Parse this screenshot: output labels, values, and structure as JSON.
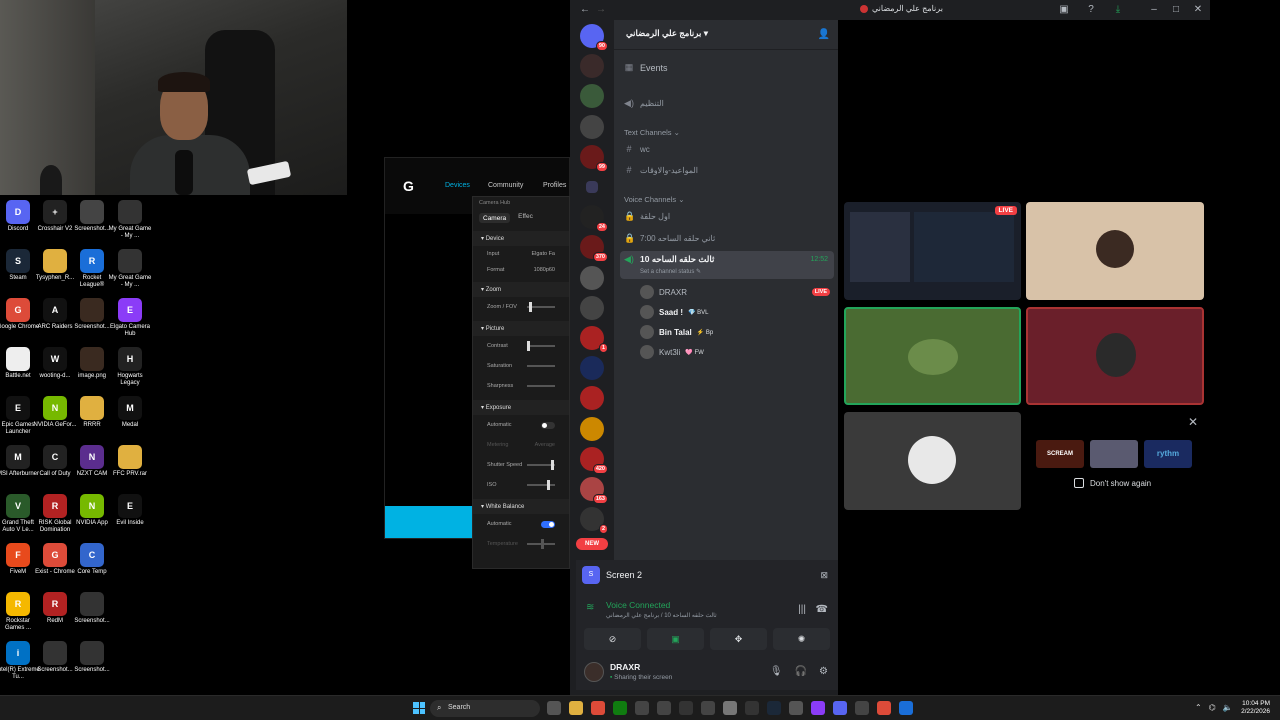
{
  "desktop": {
    "icons": [
      {
        "label": "Discord",
        "color": "#5865f2",
        "glyph": "D"
      },
      {
        "label": "Crosshair V2",
        "color": "#222222",
        "glyph": "+"
      },
      {
        "label": "Screenshot...",
        "color": "#444444",
        "glyph": ""
      },
      {
        "label": "My Great Game - My ...",
        "color": "#333333",
        "glyph": ""
      },
      {
        "label": "Steam",
        "color": "#1b2838",
        "glyph": "S"
      },
      {
        "label": "Tysyphen_R...",
        "color": "#e0b040",
        "glyph": ""
      },
      {
        "label": "Rocket League®",
        "color": "#1a6ed8",
        "glyph": "R"
      },
      {
        "label": "My Great Game - My ...",
        "color": "#333333",
        "glyph": ""
      },
      {
        "label": "Google Chrome",
        "color": "#dd4b39",
        "glyph": "G"
      },
      {
        "label": "ARC Raiders",
        "color": "#111111",
        "glyph": "A"
      },
      {
        "label": "Screenshot...",
        "color": "#3a2a20",
        "glyph": ""
      },
      {
        "label": "Elgato Camera Hub",
        "color": "#8b3cf7",
        "glyph": "E"
      },
      {
        "label": "Battle.net",
        "color": "#eeeeee",
        "glyph": ""
      },
      {
        "label": "wooting-d...",
        "color": "#111111",
        "glyph": "W"
      },
      {
        "label": "image.png",
        "color": "#3a2a20",
        "glyph": ""
      },
      {
        "label": "Hogwarts Legacy",
        "color": "#222222",
        "glyph": "H"
      },
      {
        "label": "Epic Games Launcher",
        "color": "#111111",
        "glyph": "E"
      },
      {
        "label": "NVIDIA GeFor...",
        "color": "#76b900",
        "glyph": "N"
      },
      {
        "label": "RRRR",
        "color": "#e0b040",
        "glyph": ""
      },
      {
        "label": "Medal",
        "color": "#111111",
        "glyph": "M"
      },
      {
        "label": "MSI Afterburner",
        "color": "#222222",
        "glyph": "M"
      },
      {
        "label": "Call of Duty",
        "color": "#222222",
        "glyph": "C"
      },
      {
        "label": "NZXT CAM",
        "color": "#5b2d8e",
        "glyph": "N"
      },
      {
        "label": "FFC PRV.rar",
        "color": "#e0b040",
        "glyph": ""
      },
      {
        "label": "Grand Theft Auto V Le...",
        "color": "#2a5a2a",
        "glyph": "V"
      },
      {
        "label": "RISK Global Domination",
        "color": "#b22222",
        "glyph": "R"
      },
      {
        "label": "NVIDIA App",
        "color": "#76b900",
        "glyph": "N"
      },
      {
        "label": "Evil Inside",
        "color": "#111111",
        "glyph": "E"
      },
      {
        "label": "FiveM",
        "color": "#e84a1c",
        "glyph": "F"
      },
      {
        "label": "Exist - Chrome",
        "color": "#dd4b39",
        "glyph": "G"
      },
      {
        "label": "Core Temp",
        "color": "#3366cc",
        "glyph": "C"
      },
      {
        "label": "",
        "color": "#000000",
        "glyph": ""
      },
      {
        "label": "Rockstar Games ...",
        "color": "#f5b800",
        "glyph": "R"
      },
      {
        "label": "RedM",
        "color": "#b22222",
        "glyph": "R"
      },
      {
        "label": "Screenshot...",
        "color": "#333333",
        "glyph": ""
      },
      {
        "label": "",
        "color": "#000000",
        "glyph": ""
      },
      {
        "label": "Intel(R) Extreme Tu...",
        "color": "#0071c5",
        "glyph": "i"
      },
      {
        "label": "Screenshot...",
        "color": "#333333",
        "glyph": ""
      },
      {
        "label": "Screenshot...",
        "color": "#333333",
        "glyph": ""
      }
    ]
  },
  "logitech": {
    "nav_devices": "Devices",
    "nav_community": "Community",
    "nav_profiles": "Profiles"
  },
  "camerahub": {
    "title": "Camera Hub",
    "tab_camera": "Camera",
    "tab_effects": "Effec",
    "sec_device": "Device",
    "input_label": "Input",
    "input_value": "Elgato Fa",
    "format_label": "Format",
    "format_value": "1080p60",
    "sec_zoom": "Zoom",
    "zoom_fov": "Zoom / FOV",
    "sec_picture": "Picture",
    "contrast": "Contrast",
    "saturation": "Saturation",
    "sharpness": "Sharpness",
    "sec_exposure": "Exposure",
    "automatic": "Automatic",
    "metering": "Metering",
    "metering_value": "Average",
    "shutter_speed": "Shutter Speed",
    "iso": "ISO",
    "sec_wb": "White Balance",
    "automatic2": "Automatic",
    "temperature": "Temperature"
  },
  "discord": {
    "window_title": "برنامج علي الرمضاني",
    "server_name": "برنامج علي الرمضاني",
    "events": "Events",
    "announce_channel": "التنظيم",
    "text_channels_label": "Text Channels",
    "text_channels": [
      "wc",
      "المواعيد-والاوقات"
    ],
    "voice_channels_label": "Voice Channels",
    "voice_channels": [
      "اول حلقة",
      "ثاني حلقه الساحه 7:00"
    ],
    "active_voice_channel": "ثالث حلقه الساحه 10",
    "active_timer": "12:52",
    "set_status": "Set a channel status",
    "voice_users": [
      {
        "name": "DRAXR",
        "tag": "",
        "live": "LIVE"
      },
      {
        "name": "Saad !",
        "tag": "💎 BVL",
        "live": ""
      },
      {
        "name": "Bin Talal",
        "tag": "⚡ Bp",
        "live": ""
      },
      {
        "name": "Kwt3li",
        "tag": "🩷 FW",
        "live": ""
      }
    ],
    "guild_badges": [
      "90",
      "",
      "",
      "",
      "99",
      "",
      "24",
      "370",
      "",
      "",
      "1",
      "",
      "",
      "",
      "420",
      "163",
      "2"
    ],
    "new_label": "NEW",
    "screen_label": "Screen 2",
    "voice_connected": "Voice Connected",
    "voice_sub": "ثالث حلقه الساحه 10 / برنامج علي الرمضاني",
    "username": "DRAXR",
    "user_status": "Sharing their screen",
    "live_tag": "LIVE",
    "promo_close": "✕",
    "dont_show": "Don't show again",
    "promo_brands": [
      "SCREAM",
      "rythm"
    ]
  },
  "taskbar": {
    "search": "Search",
    "time": "10:04 PM",
    "date": "2/22/2026"
  },
  "colors": {
    "discord_bg": "#1e1f22",
    "channels_bg": "#2b2d31",
    "accent_green": "#23a55a",
    "live_red": "#f23f43",
    "blurple": "#5865f2",
    "logi_cyan": "#00b2e3"
  }
}
